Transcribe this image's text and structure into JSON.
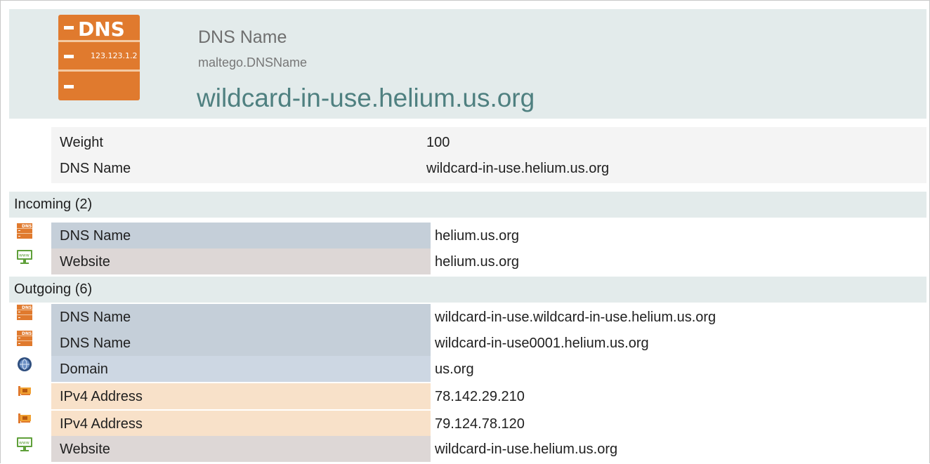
{
  "entity": {
    "type_label": "DNS Name",
    "class_name": "maltego.DNSName",
    "value": "wildcard-in-use.helium.us.org",
    "icon": "dns-server-icon",
    "icon_text_top": "DNS",
    "icon_text_ip": "123.123.1.2"
  },
  "properties": [
    {
      "key": "Weight",
      "value": "100"
    },
    {
      "key": "DNS Name",
      "value": "wildcard-in-use.helium.us.org"
    }
  ],
  "incoming": {
    "title": "Incoming (2)",
    "items": [
      {
        "type": "DNS Name",
        "value": "helium.us.org",
        "icon": "dns-icon",
        "kind": "dns"
      },
      {
        "type": "Website",
        "value": "helium.us.org",
        "icon": "website-icon",
        "kind": "web"
      }
    ]
  },
  "outgoing": {
    "title": "Outgoing (6)",
    "items": [
      {
        "type": "DNS Name",
        "value": "wildcard-in-use.wildcard-in-use.helium.us.org",
        "icon": "dns-icon",
        "kind": "dns"
      },
      {
        "type": "DNS Name",
        "value": "wildcard-in-use0001.helium.us.org",
        "icon": "dns-icon",
        "kind": "dns"
      },
      {
        "type": "Domain",
        "value": "us.org",
        "icon": "globe-icon",
        "kind": "domain"
      },
      {
        "type": "IPv4 Address",
        "value": "78.142.29.210",
        "icon": "network-card-icon",
        "kind": "ip"
      },
      {
        "type": "IPv4 Address",
        "value": "79.124.78.120",
        "icon": "network-card-icon",
        "kind": "ip"
      },
      {
        "type": "Website",
        "value": "wildcard-in-use.helium.us.org",
        "icon": "website-icon",
        "kind": "web"
      }
    ]
  },
  "colors": {
    "header_bg": "#e3ebeb",
    "entity_value": "#4f8080",
    "dns_row": "#c5cfd9",
    "website_row": "#ddd7d6",
    "domain_row": "#cdd7e3",
    "ip_row": "#f8e1c9",
    "dns_icon": "#e07a2e"
  }
}
